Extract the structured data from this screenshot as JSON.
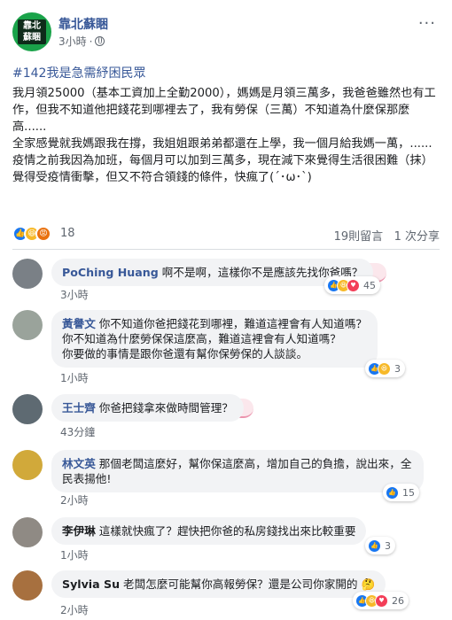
{
  "post": {
    "page_name": "靠北蘇睏",
    "avatar_text": "靠北\n蘇睏",
    "time": "3小時",
    "hashtag": "#142我是急需紓困民眾",
    "body_lines": [
      "我月領25000（基本工資加上全勤2000），媽媽是月領三萬多，我爸爸雖然也有工作，但我不知道他把錢花到哪裡去了，我有勞保（三萬）不知道為什麼保那麼高......",
      "全家感覺就我媽跟我在撐，我姐姐跟弟弟都還在上學，我一個月給我媽一萬，......疫情之前我因為加班，每個月可以加到三萬多，現在減下來覺得生活很困難（抹）",
      "覺得受疫情衝擊，但又不符合領錢的條件，快瘋了(´･ω･`)"
    ],
    "reactions_count": "18",
    "comments_count": "19則留言",
    "shares_count": "1 次分享"
  },
  "comments": [
    {
      "name": "PoChing Huang",
      "text": "啊不是啊，這樣你不是應該先找你爸嗎？",
      "time": "3小時",
      "reactions": "45"
    },
    {
      "name": "黃譽文",
      "text": "你不知道你爸把錢花到哪裡，難道這裡會有人知道嗎？\n你不知道為什麼勞保保這麼高，難道這裡會有人知道嗎？\n你要做的事情是跟你爸還有幫你保勞保的人談談。",
      "time": "1小時",
      "reactions": "3"
    },
    {
      "name": "王士齊",
      "text": "你爸把錢拿來做時間管理？",
      "time": "43分鐘",
      "reactions": ""
    },
    {
      "name": "林文英",
      "text": "那個老闆這麼好，幫你保這麼高，增加自己的負擔，說出來，全民表揚他!",
      "time": "2小時",
      "reactions": "15"
    },
    {
      "name": "李伊琳",
      "text": "這樣就快瘋了？趕快把你爸的私房錢找出來比較重要",
      "time": "1小時",
      "reactions": "3"
    },
    {
      "name": "Sylvia Su",
      "text": "老闆怎麼可能幫你高報勞保？還是公司你家開的 🤔",
      "time": "2小時",
      "reactions": "26"
    }
  ],
  "icons": {
    "like": "thumbs-up-icon",
    "haha": "haha-icon",
    "angry": "angry-icon",
    "love": "heart-icon",
    "globe": "globe-icon"
  },
  "colors": {
    "link": "#385898",
    "like": "#1877f2",
    "haha": "#f7b928",
    "angry": "#e9710f",
    "love": "#f33e58",
    "bubble": "#f2f3f5"
  }
}
